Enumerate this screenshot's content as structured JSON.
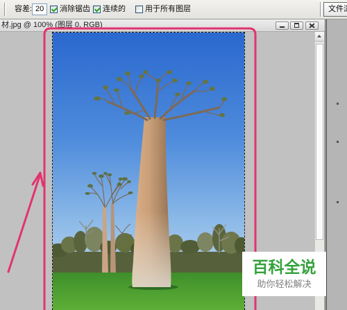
{
  "toolbar": {
    "tolerance_label": "容差:",
    "tolerance_value": "20",
    "options": [
      {
        "label": "消除锯齿",
        "checked": true
      },
      {
        "label": "连续的",
        "checked": true
      },
      {
        "label": "用于所有图层",
        "checked": false
      }
    ],
    "file_browser_label": "文件浏"
  },
  "document": {
    "title": "材.jpg @ 100% (图层 0, RGB)",
    "window_buttons": [
      "minimize-icon",
      "restore-icon",
      "close-icon"
    ]
  },
  "watermark": {
    "title": "百科全说",
    "subtitle": "助你轻松解决",
    "title_color": "#34a23c",
    "subtitle_color": "#808080"
  },
  "colors": {
    "annotation": "#e2336f",
    "canvas_background": "#c1c1c1"
  }
}
